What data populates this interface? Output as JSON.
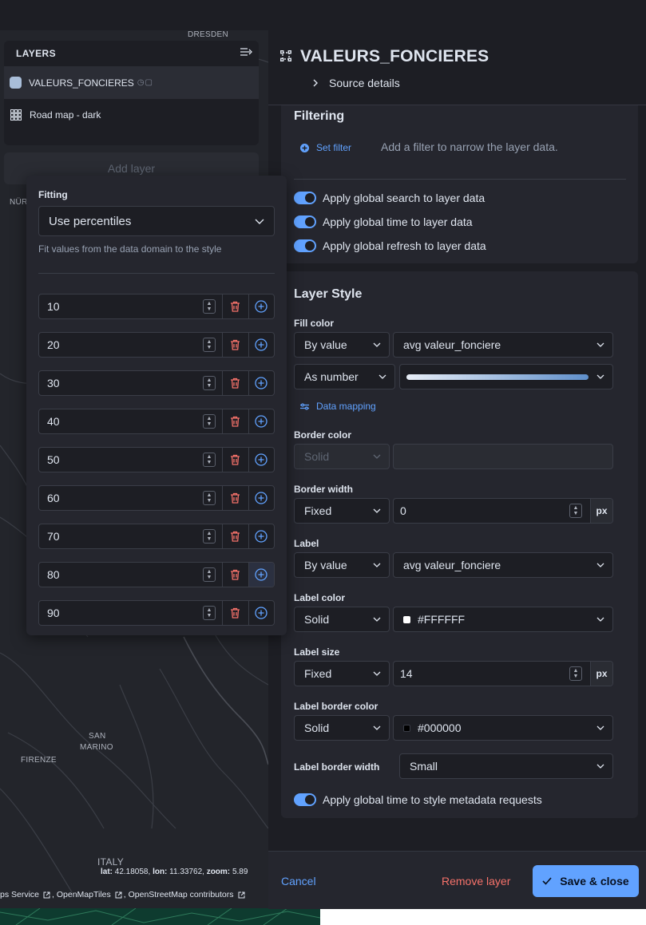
{
  "colors": {
    "accent": "#61a2ff",
    "danger": "#f6726a",
    "panel": "#1d1e24",
    "card": "#25262e",
    "layer_swatch": "#a9bed9"
  },
  "map": {
    "places": [
      "DRESDEN",
      "NÜR",
      "SAN",
      "MARINO",
      "FIRENZE",
      "ITALY"
    ],
    "coords": {
      "lat_label": "lat:",
      "lat": "42.18058,",
      "lon_label": "lon:",
      "lon": "11.33762,",
      "zoom_label": "zoom:",
      "zoom": "5.89"
    },
    "attribution": {
      "part1": "ps Service",
      "part2": ", OpenMapTiles",
      "part3": ", OpenStreetMap contributors"
    }
  },
  "layers": {
    "title": "LAYERS",
    "collapse_icon": "collapse-icon",
    "items": [
      {
        "label": "VALEURS_FONCIERES",
        "icon": "color-swatch"
      },
      {
        "label": "Road map - dark",
        "icon": "grid-icon"
      }
    ],
    "add_layer_label": "Add layer"
  },
  "fitting": {
    "label": "Fitting",
    "selected": "Use percentiles",
    "help": "Fit values from the data domain to the style",
    "percentiles": [
      "10",
      "20",
      "30",
      "40",
      "50",
      "60",
      "70",
      "80",
      "90"
    ]
  },
  "panel": {
    "title": "VALEURS_FONCIERES",
    "source_details": "Source details",
    "filtering": {
      "title": "Filtering",
      "set_filter": "Set filter",
      "hint": "Add a filter to narrow the layer data.",
      "toggles": [
        "Apply global search to layer data",
        "Apply global time to layer data",
        "Apply global refresh to layer data"
      ]
    },
    "style": {
      "title": "Layer Style",
      "fill_color": {
        "label": "Fill color",
        "mode": "By value",
        "field": "avg valeur_fonciere",
        "format": "As number",
        "data_mapping": "Data mapping"
      },
      "border_color": {
        "label": "Border color",
        "mode": "Solid"
      },
      "border_width": {
        "label": "Border width",
        "mode": "Fixed",
        "value": "0",
        "unit": "px"
      },
      "label": {
        "label": "Label",
        "mode": "By value",
        "field": "avg valeur_fonciere"
      },
      "label_color": {
        "label": "Label color",
        "mode": "Solid",
        "value": "#FFFFFF"
      },
      "label_size": {
        "label": "Label size",
        "mode": "Fixed",
        "value": "14",
        "unit": "px"
      },
      "label_border_color": {
        "label": "Label border color",
        "mode": "Solid",
        "value": "#000000"
      },
      "label_border_width": {
        "label": "Label border width",
        "value": "Small"
      },
      "time_toggle": "Apply global time to style metadata requests"
    }
  },
  "footer": {
    "cancel": "Cancel",
    "remove": "Remove layer",
    "save": "Save & close"
  }
}
